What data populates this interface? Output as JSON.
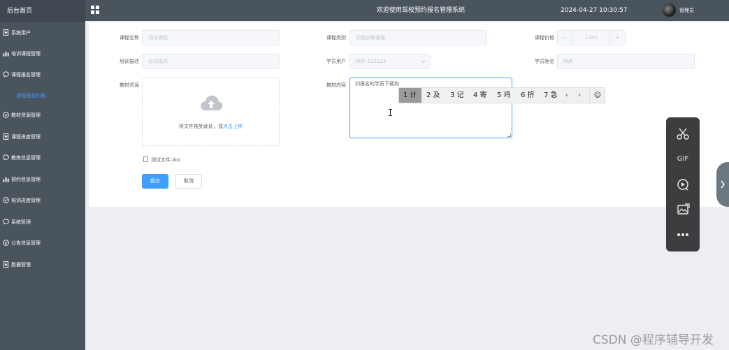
{
  "sidebar": {
    "brand": "后台首页",
    "items": [
      {
        "label": "系统用户",
        "icon": "document-icon"
      },
      {
        "label": "培训课程管理",
        "icon": "bar-chart-icon"
      },
      {
        "label": "课程报名管理",
        "icon": "chat-icon"
      },
      {
        "label": "教材资源管理",
        "icon": "check-circle-icon"
      },
      {
        "label": "课程进度管理",
        "icon": "document-icon"
      },
      {
        "label": "教练信息管理",
        "icon": "chat-icon"
      },
      {
        "label": "预约信息管理",
        "icon": "bar-chart-icon"
      },
      {
        "label": "培训进度管理",
        "icon": "check-circle-icon"
      },
      {
        "label": "系统管理",
        "icon": "chat-icon"
      },
      {
        "label": "公告信息管理",
        "icon": "check-circle-icon"
      },
      {
        "label": "数据管理",
        "icon": "document-icon"
      }
    ],
    "active_sub": "课程报名列表"
  },
  "topbar": {
    "title": "欢迎使用驾校预约报名管理系统",
    "datetime": "2024-04-27 10:30:57",
    "user": "管理员"
  },
  "form": {
    "course_name": {
      "label": "课程名称",
      "placeholder": "测试课程"
    },
    "course_type": {
      "label": "课程类别",
      "placeholder": "实践训练课程"
    },
    "course_price": {
      "label": "课程价格",
      "value": "1200"
    },
    "training_desc": {
      "label": "培训描述",
      "placeholder": "培训描述"
    },
    "student_user": {
      "label": "学员用户",
      "value": "阿萨-123123"
    },
    "student_name": {
      "label": "学员姓名",
      "placeholder": "阿萨"
    },
    "material_resource": {
      "label": "教材资源"
    },
    "material_content": {
      "label": "教材内容",
      "value": "刘报名的学员下载和"
    },
    "upload_text": "将文件拖到此处，或",
    "upload_link": "点击上传",
    "file_name": "测试文件.doc",
    "submit": "提交",
    "cancel": "取消"
  },
  "ime": {
    "candidates": [
      "1 计",
      "2 及",
      "3 记",
      "4 寄",
      "5 鸡",
      "6 挤",
      "7 急"
    ],
    "prev": "‹",
    "next": "›",
    "emoji": "☺"
  },
  "tools": {
    "items": [
      {
        "icon": "scissors-icon"
      },
      {
        "icon": "gif-icon",
        "label": "GIF"
      },
      {
        "icon": "record-icon"
      },
      {
        "icon": "image-icon"
      },
      {
        "icon": "more-icon"
      }
    ]
  },
  "watermark": "CSDN @程序辅导开发",
  "colors": {
    "accent": "#409eff",
    "sidebar": "#4a545d"
  }
}
